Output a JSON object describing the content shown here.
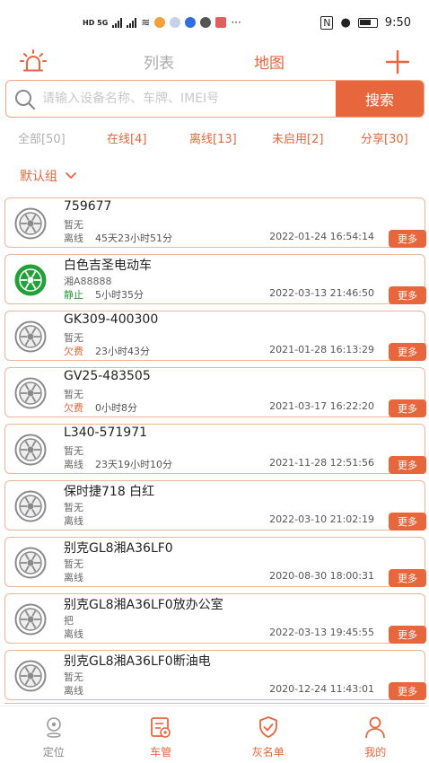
{
  "status_bar": {
    "left_badges": [
      "HD 5G",
      "4G",
      "4G"
    ],
    "time": "9:50"
  },
  "header": {
    "tabs": [
      {
        "label": "列表",
        "active": false
      },
      {
        "label": "地图",
        "active": true
      }
    ],
    "accent_color": "#e8663c"
  },
  "search": {
    "placeholder": "请输入设备名称、车牌、IMEI号",
    "value": "",
    "button_label": "搜索"
  },
  "filters": [
    {
      "label": "全部[50]"
    },
    {
      "label": "在线[4]"
    },
    {
      "label": "离线[13]"
    },
    {
      "label": "未启用[2]"
    },
    {
      "label": "分享[30]"
    }
  ],
  "group": {
    "label": "默认组"
  },
  "devices": [
    {
      "name": "759677",
      "plate": "暂无",
      "status": "离线",
      "status_type": "offline",
      "duration": "45天23小时51分",
      "time": "2022-01-24 16:54:14",
      "icon": "wheel-gray-icon"
    },
    {
      "name": "白色吉圣电动车",
      "plate": "湘A88888",
      "status": "静止",
      "status_type": "static",
      "duration": "5小时35分",
      "time": "2022-03-13 21:46:50",
      "icon": "wheel-green-icon"
    },
    {
      "name": "GK309-400300",
      "plate": "暂无",
      "status": "欠费",
      "status_type": "owed",
      "duration": "23小时43分",
      "time": "2021-01-28 16:13:29",
      "icon": "wheel-gray-icon"
    },
    {
      "name": "GV25-483505",
      "plate": "暂无",
      "status": "欠费",
      "status_type": "owed",
      "duration": "0小时8分",
      "time": "2021-03-17 16:22:20",
      "icon": "wheel-gray-icon"
    },
    {
      "name": "L340-571971",
      "plate": "暂无",
      "status": "离线",
      "status_type": "offline",
      "duration": "23天19小时10分",
      "time": "2021-11-28 12:51:56",
      "icon": "wheel-gray-icon"
    },
    {
      "name": "保时捷718 白红",
      "plate": "暂无",
      "status": "离线",
      "status_type": "offline",
      "duration": "",
      "time": "2022-03-10 21:02:19",
      "icon": "wheel-gray-icon"
    },
    {
      "name": "别克GL8湘A36LF0",
      "plate": "暂无",
      "status": "离线",
      "status_type": "offline",
      "duration": "",
      "time": "2020-08-30 18:00:31",
      "icon": "wheel-gray-icon"
    },
    {
      "name": "别克GL8湘A36LF0放办公室",
      "plate": "把",
      "status": "离线",
      "status_type": "offline",
      "duration": "",
      "time": "2022-03-13 19:45:55",
      "icon": "wheel-gray-icon"
    },
    {
      "name": "别克GL8湘A36LF0断油电",
      "plate": "暂无",
      "status": "离线",
      "status_type": "offline",
      "duration": "",
      "time": "2020-12-24 11:43:01",
      "icon": "wheel-gray-icon"
    }
  ],
  "more_label": "更多",
  "bottom_nav": [
    {
      "label": "定位",
      "icon": "location-icon",
      "active": false
    },
    {
      "label": "车管",
      "icon": "car-manage-icon",
      "active": true
    },
    {
      "label": "灰名单",
      "icon": "shield-check-icon",
      "active": false
    },
    {
      "label": "我的",
      "icon": "person-icon",
      "active": false
    }
  ]
}
